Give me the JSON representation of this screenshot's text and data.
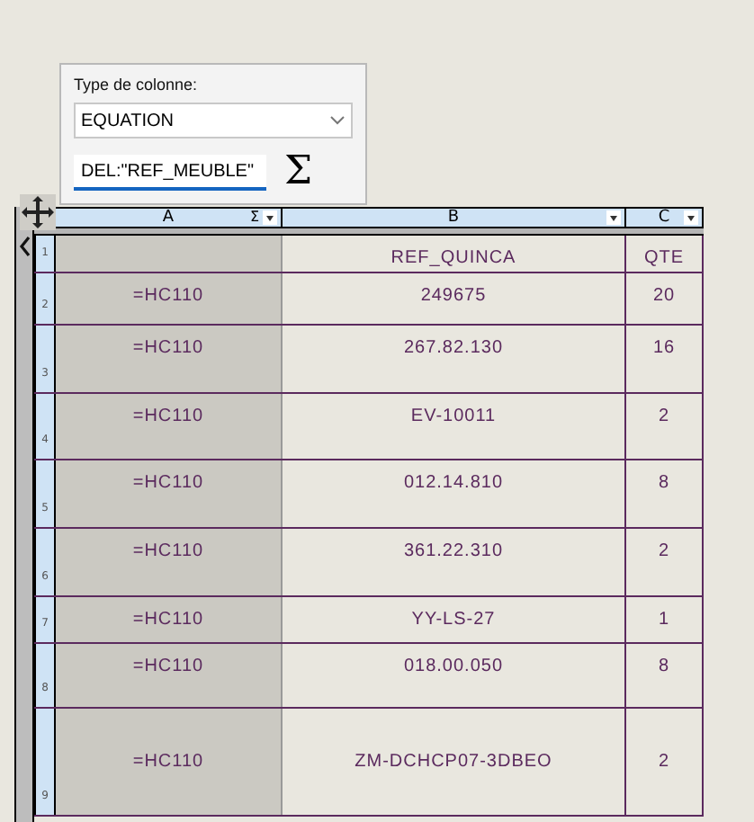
{
  "panel": {
    "label": "Type de colonne:",
    "column_type": "EQUATION",
    "formula": "DEL:\"REF_MEUBLE\"",
    "sum_button": "Σ"
  },
  "columns": [
    {
      "letter": "A",
      "sum_mark": "Σ"
    },
    {
      "letter": "B"
    },
    {
      "letter": "C"
    }
  ],
  "rows": [
    {
      "number": "1",
      "cells": [
        "",
        "REF_QUINCA",
        "QTE"
      ]
    },
    {
      "number": "2",
      "cells": [
        "=HC110",
        "249675",
        "20"
      ]
    },
    {
      "number": "3",
      "cells": [
        "=HC110",
        "267.82.130",
        "16"
      ]
    },
    {
      "number": "4",
      "cells": [
        "=HC110",
        "EV-10011",
        "2"
      ]
    },
    {
      "number": "5",
      "cells": [
        "=HC110",
        "012.14.810",
        "8"
      ]
    },
    {
      "number": "6",
      "cells": [
        "=HC110",
        "361.22.310",
        "2"
      ]
    },
    {
      "number": "7",
      "cells": [
        "=HC110",
        "YY-LS-27",
        "1"
      ]
    },
    {
      "number": "8",
      "cells": [
        "=HC110",
        "018.00.050",
        "8"
      ]
    },
    {
      "number": "9",
      "cells": [
        "=HC110",
        "ZM-DCHCP07-3DBEO",
        "2"
      ]
    }
  ]
}
